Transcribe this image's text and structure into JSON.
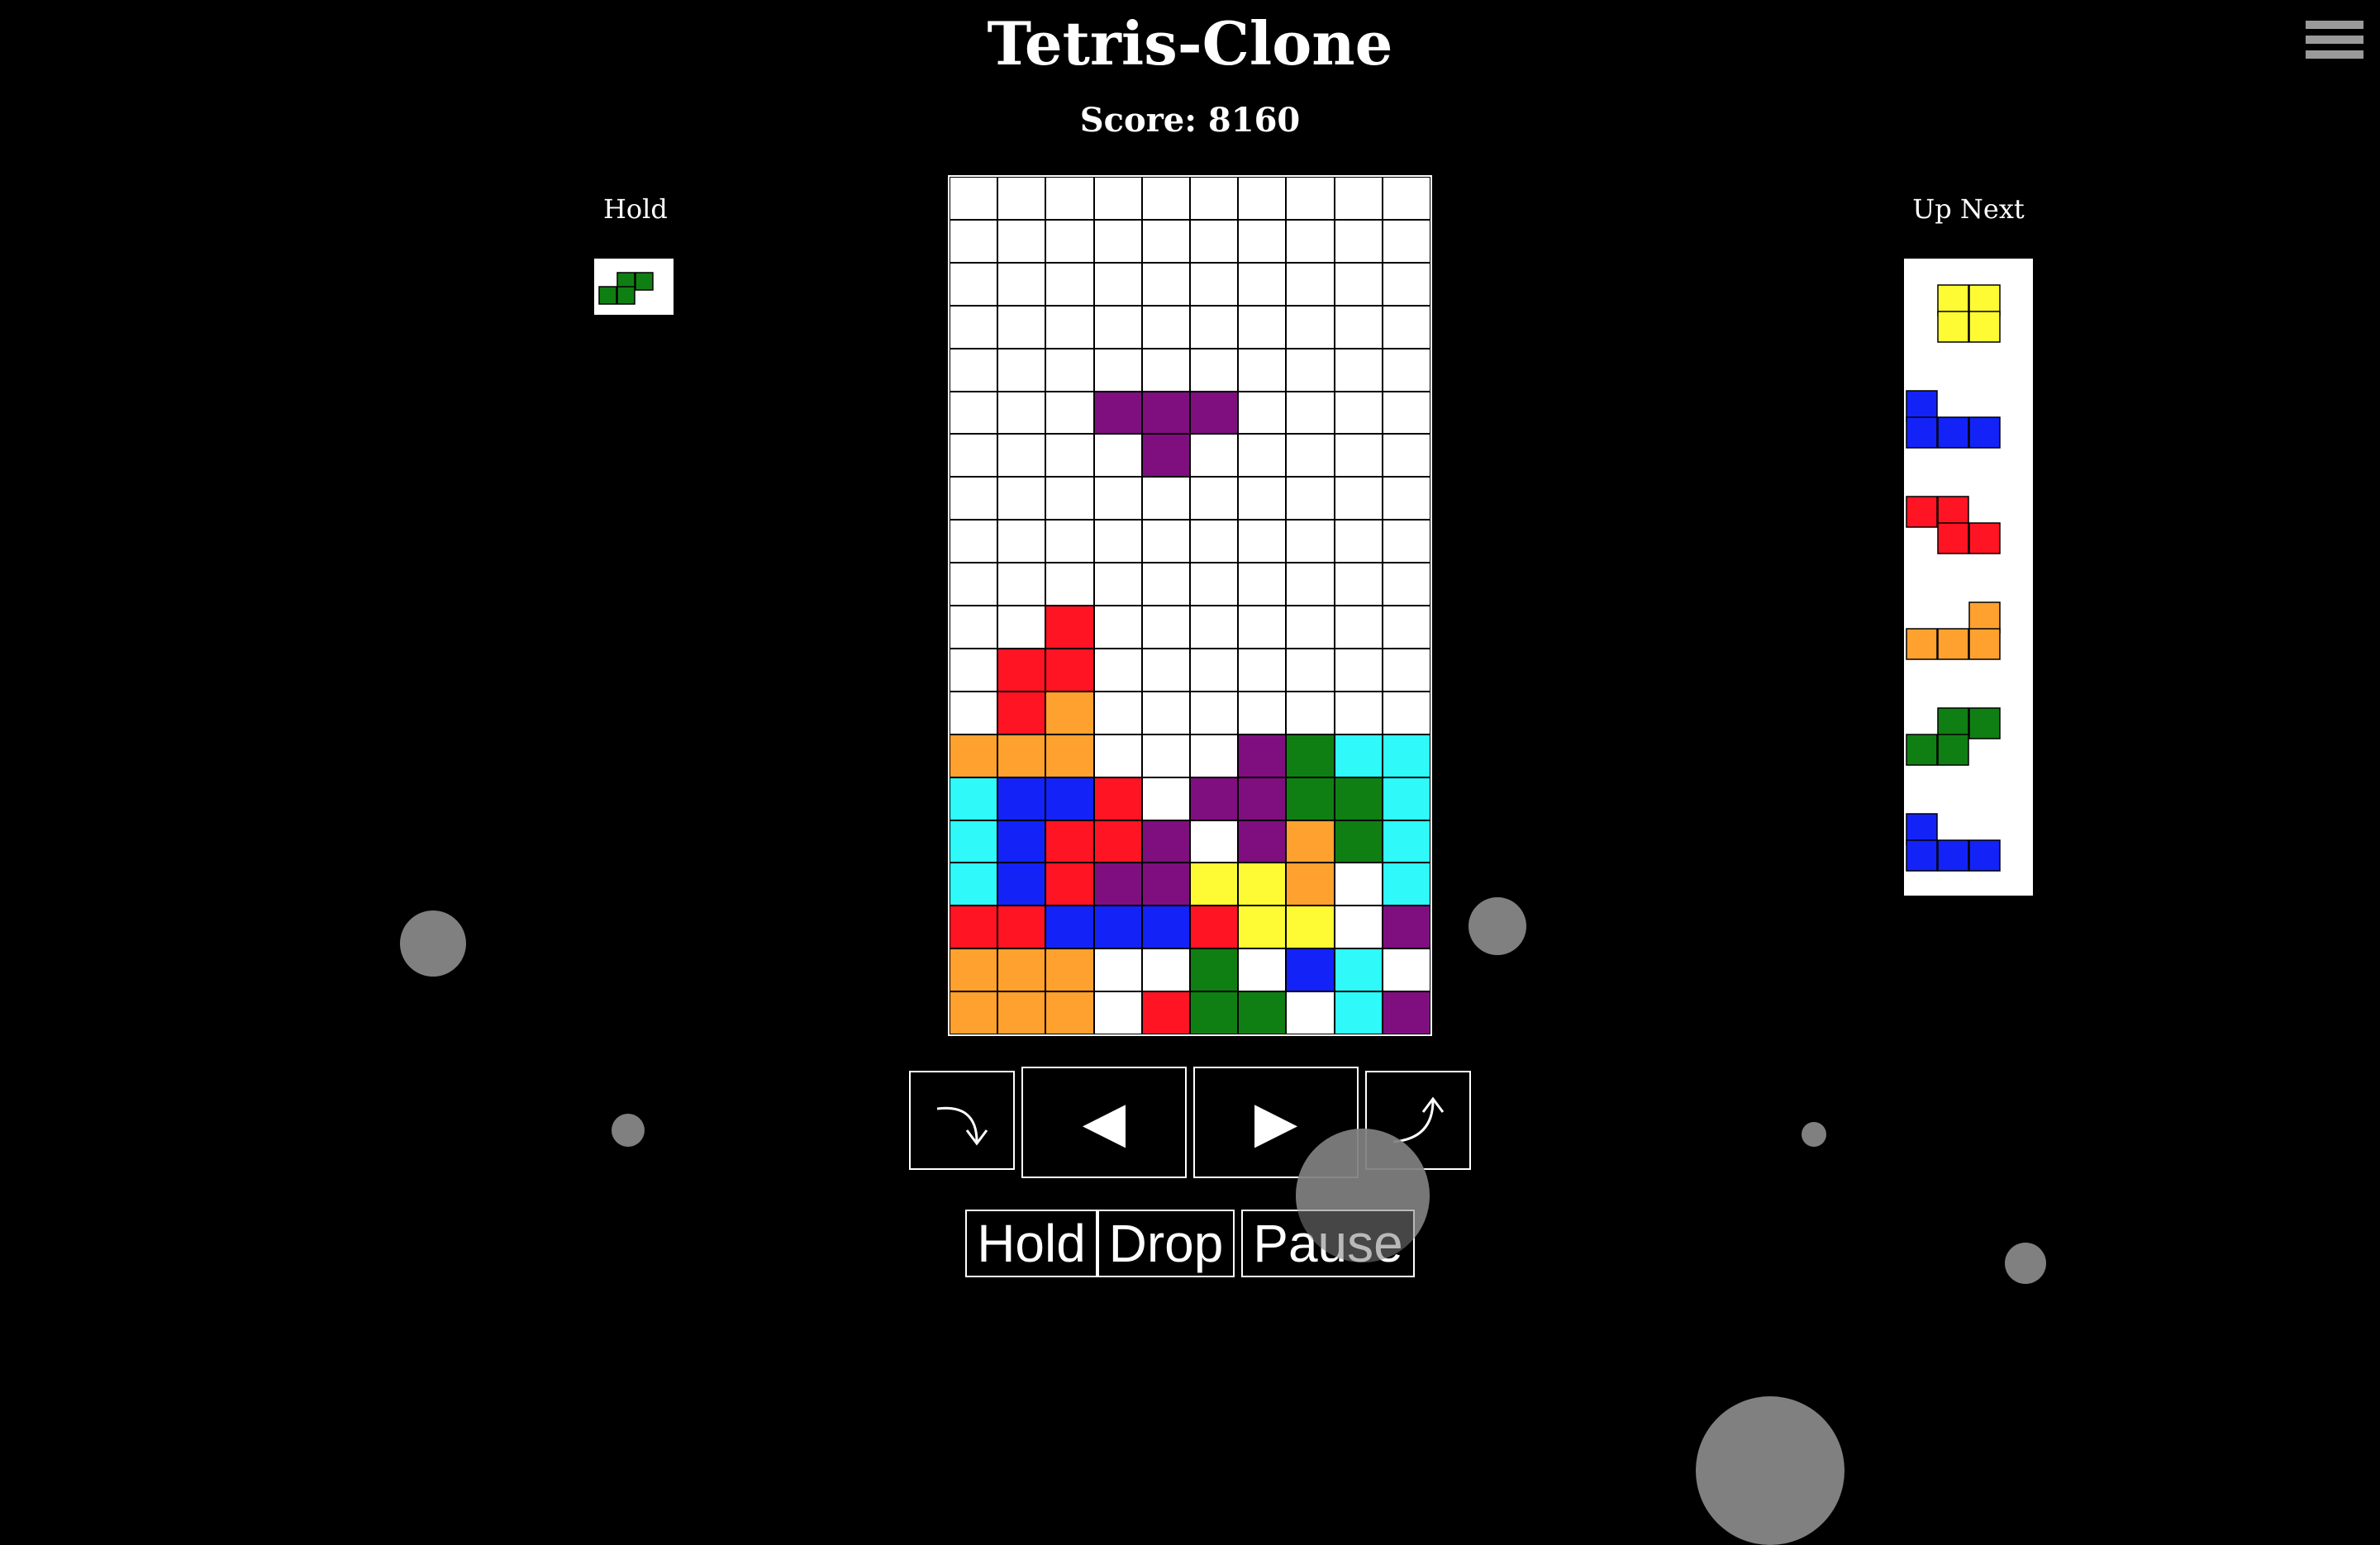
{
  "title": "Tetris-Clone",
  "score_label": "Score: 8160",
  "menu_icon": "hamburger-menu-icon",
  "hold": {
    "label": "Hold",
    "piece": "S",
    "blocks": [
      [
        0,
        1,
        "green"
      ],
      [
        0,
        2,
        "green"
      ],
      [
        1,
        0,
        "green"
      ],
      [
        1,
        1,
        "green"
      ]
    ]
  },
  "up_next": {
    "label": "Up Next",
    "pieces": [
      {
        "type": "O",
        "color": "yellow",
        "blocks": [
          [
            0,
            1
          ],
          [
            0,
            2
          ],
          [
            1,
            1
          ],
          [
            1,
            2
          ]
        ]
      },
      {
        "type": "J",
        "color": "blue",
        "blocks": [
          [
            0,
            0
          ],
          [
            1,
            0
          ],
          [
            1,
            1
          ],
          [
            1,
            2
          ]
        ]
      },
      {
        "type": "Z",
        "color": "red",
        "blocks": [
          [
            0,
            0
          ],
          [
            0,
            1
          ],
          [
            1,
            1
          ],
          [
            1,
            2
          ]
        ]
      },
      {
        "type": "L",
        "color": "orange",
        "blocks": [
          [
            0,
            2
          ],
          [
            1,
            0
          ],
          [
            1,
            1
          ],
          [
            1,
            2
          ]
        ]
      },
      {
        "type": "S",
        "color": "green",
        "blocks": [
          [
            0,
            1
          ],
          [
            0,
            2
          ],
          [
            1,
            0
          ],
          [
            1,
            1
          ]
        ]
      },
      {
        "type": "J",
        "color": "blue",
        "blocks": [
          [
            0,
            0
          ],
          [
            1,
            0
          ],
          [
            1,
            1
          ],
          [
            1,
            2
          ]
        ]
      }
    ]
  },
  "colors": {
    ".": "#ffffff",
    "P": "#7f0f7f",
    "R": "#fe1423",
    "O": "#fea12f",
    "C": "#2ff9f9",
    "B": "#1323f7",
    "G": "#107f13",
    "Y": "#fefb34",
    "purple": "#7f0f7f",
    "red": "#fe1423",
    "orange": "#fea12f",
    "cyan": "#2ff9f9",
    "blue": "#1323f7",
    "green": "#107f13",
    "yellow": "#fefb34"
  },
  "board": [
    "..........",
    "..........",
    "..........",
    "..........",
    "..........",
    "...PPP....",
    "....P.....",
    "..........",
    "..........",
    "..........",
    "..R.......",
    ".RR.......",
    ".RO.......",
    "OOO...PGCC",
    "CBBR.PPGGC",
    "CBRRP.POGC",
    "CBRPPYYO.C",
    "RRBBBRYY.P",
    "OOO..G.BC.",
    "OOO.RGG.CP"
  ],
  "controls": {
    "rotate_cw_icon": "rotate-clockwise-icon",
    "left_icon": "left-arrow-icon",
    "left_glyph": "◀",
    "right_icon": "right-arrow-icon",
    "right_glyph": "▶",
    "rotate_ccw_icon": "rotate-counterclockwise-icon"
  },
  "actions": {
    "hold_label": "Hold",
    "drop_label": "Drop",
    "pause_label": "Pause"
  }
}
